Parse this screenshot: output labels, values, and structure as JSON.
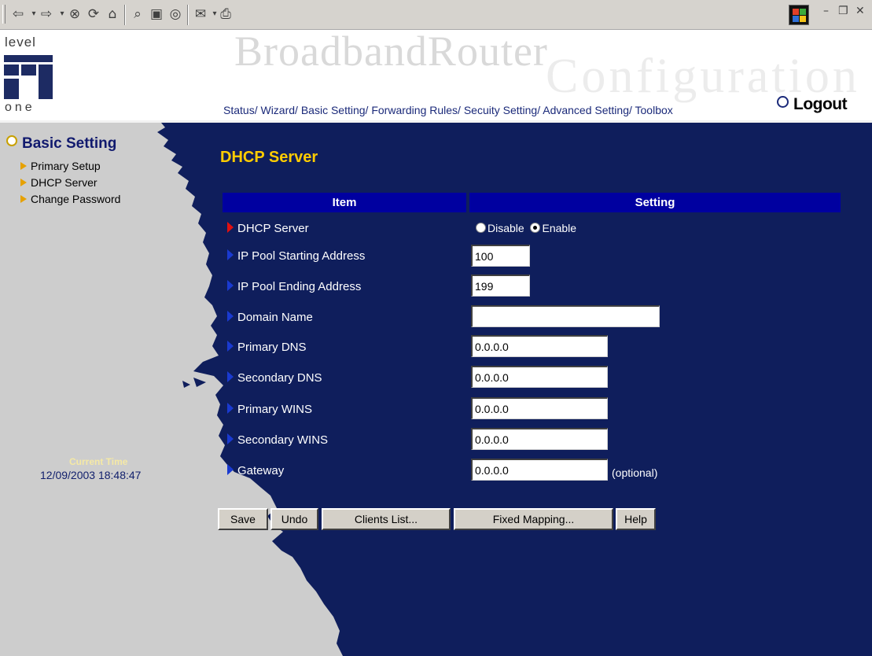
{
  "toolbar": {
    "icons": [
      "back-icon",
      "forward-icon",
      "stop-icon",
      "refresh-icon",
      "home-icon",
      "search-icon",
      "favorites-icon",
      "history-icon",
      "mail-icon",
      "print-icon"
    ]
  },
  "header": {
    "logo_top": "level",
    "logo_bottom": "one",
    "title": "BroadbandRouter",
    "subtitle": "Configuration",
    "nav": [
      "Status/",
      "Wizard/",
      "Basic Setting/",
      "Forwarding Rules/",
      "Secuity Setting/",
      "Advanced Setting/",
      "Toolbox"
    ],
    "logout": "Logout"
  },
  "sidebar": {
    "heading": "Basic Setting",
    "items": [
      {
        "label": "Primary Setup"
      },
      {
        "label": "DHCP Server"
      },
      {
        "label": "Change Password"
      }
    ],
    "time_label": "Current Time",
    "time_value": "12/09/2003 18:48:47"
  },
  "main": {
    "title": "DHCP Server",
    "col_item": "Item",
    "col_setting": "Setting",
    "rows": [
      {
        "label": "DHCP Server"
      },
      {
        "label": "IP Pool Starting Address",
        "value": "100"
      },
      {
        "label": "IP Pool Ending Address",
        "value": "199"
      },
      {
        "label": "Domain Name",
        "value": ""
      },
      {
        "label": "Primary DNS",
        "value": "0.0.0.0"
      },
      {
        "label": "Secondary DNS",
        "value": "0.0.0.0"
      },
      {
        "label": "Primary WINS",
        "value": "0.0.0.0"
      },
      {
        "label": "Secondary WINS",
        "value": "0.0.0.0"
      },
      {
        "label": "Gateway",
        "value": "0.0.0.0"
      }
    ],
    "dhcp_options": [
      "Disable",
      "Enable"
    ],
    "dhcp_selected": "Enable",
    "optional_note": "(optional)",
    "buttons": {
      "save": "Save",
      "undo": "Undo",
      "clients": "Clients List...",
      "fixed": "Fixed Mapping...",
      "help": "Help"
    }
  },
  "colors": {
    "panel_blue": "#0f1e5c",
    "header_blue": "#0000a0",
    "title_yellow": "#ffcc00",
    "sidebar_gray": "#cdcdcd"
  }
}
